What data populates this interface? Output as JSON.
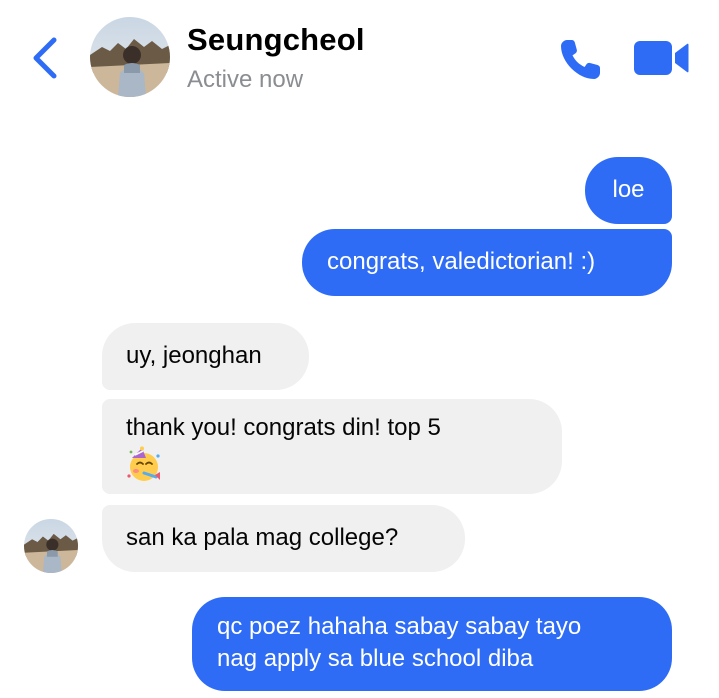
{
  "header": {
    "contact_name": "Seungcheol",
    "status": "Active now"
  },
  "colors": {
    "accent": "#2f6cf6",
    "incoming_bubble": "#f0f0f0",
    "status_text": "#8a8d91"
  },
  "icons": {
    "back": "chevron-left-icon",
    "call": "phone-icon",
    "video": "video-camera-icon",
    "emoji": "partying-face-emoji"
  },
  "messages": [
    {
      "direction": "outgoing",
      "text": "loe"
    },
    {
      "direction": "outgoing",
      "text": "congrats, valedictorian! :)"
    },
    {
      "direction": "incoming",
      "text": "uy, jeonghan"
    },
    {
      "direction": "incoming",
      "text": "thank you! congrats din! top 5",
      "emoji": "🥳"
    },
    {
      "direction": "incoming",
      "text": "san ka pala mag college?"
    },
    {
      "direction": "outgoing",
      "lines": [
        "qc poez hahaha sabay sabay tayo",
        "nag apply sa blue school diba"
      ]
    }
  ]
}
